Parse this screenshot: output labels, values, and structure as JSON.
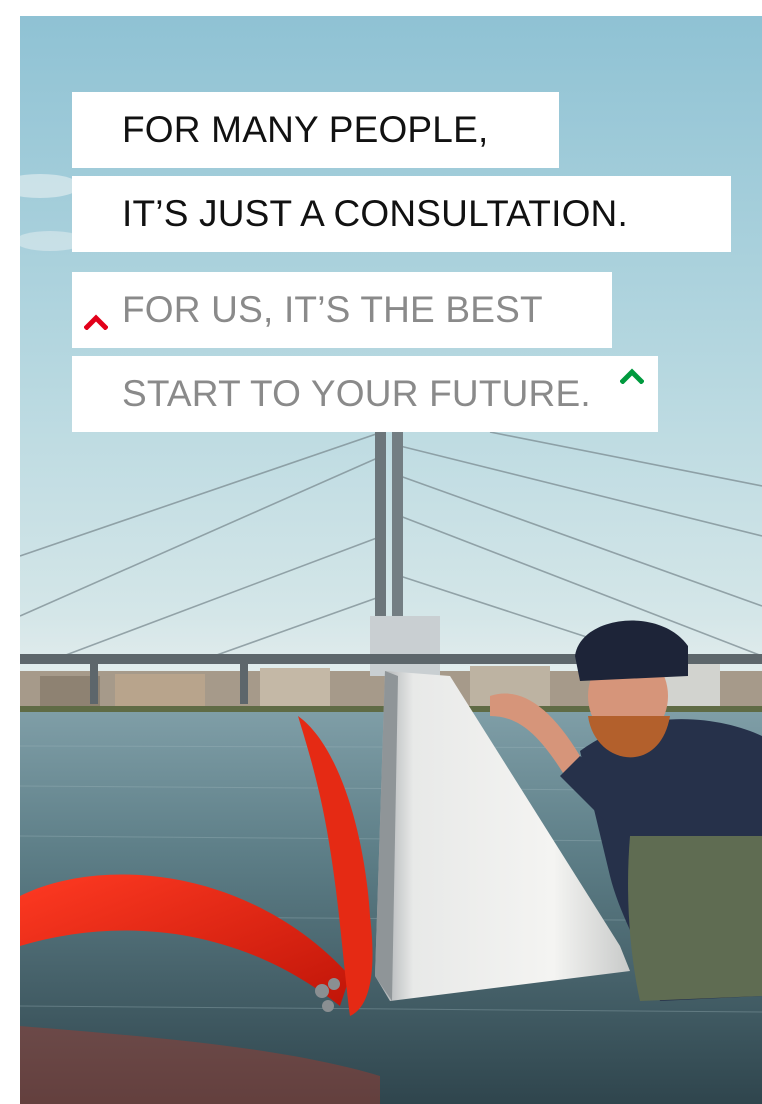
{
  "headline": {
    "line1": "FOR MANY PEOPLE,",
    "line2": "IT’S JUST A CONSULTATION."
  },
  "subline": {
    "line1": "FOR US, IT’S THE BEST",
    "line2": "START TO YOUR FUTURE."
  },
  "icons": {
    "accent_left": "chevron-up-icon",
    "accent_right": "chevron-up-icon"
  },
  "colors": {
    "accent_red": "#e2001a",
    "accent_green": "#009a3e",
    "headline_text": "#111111",
    "subline_text": "#8a8a8a"
  }
}
